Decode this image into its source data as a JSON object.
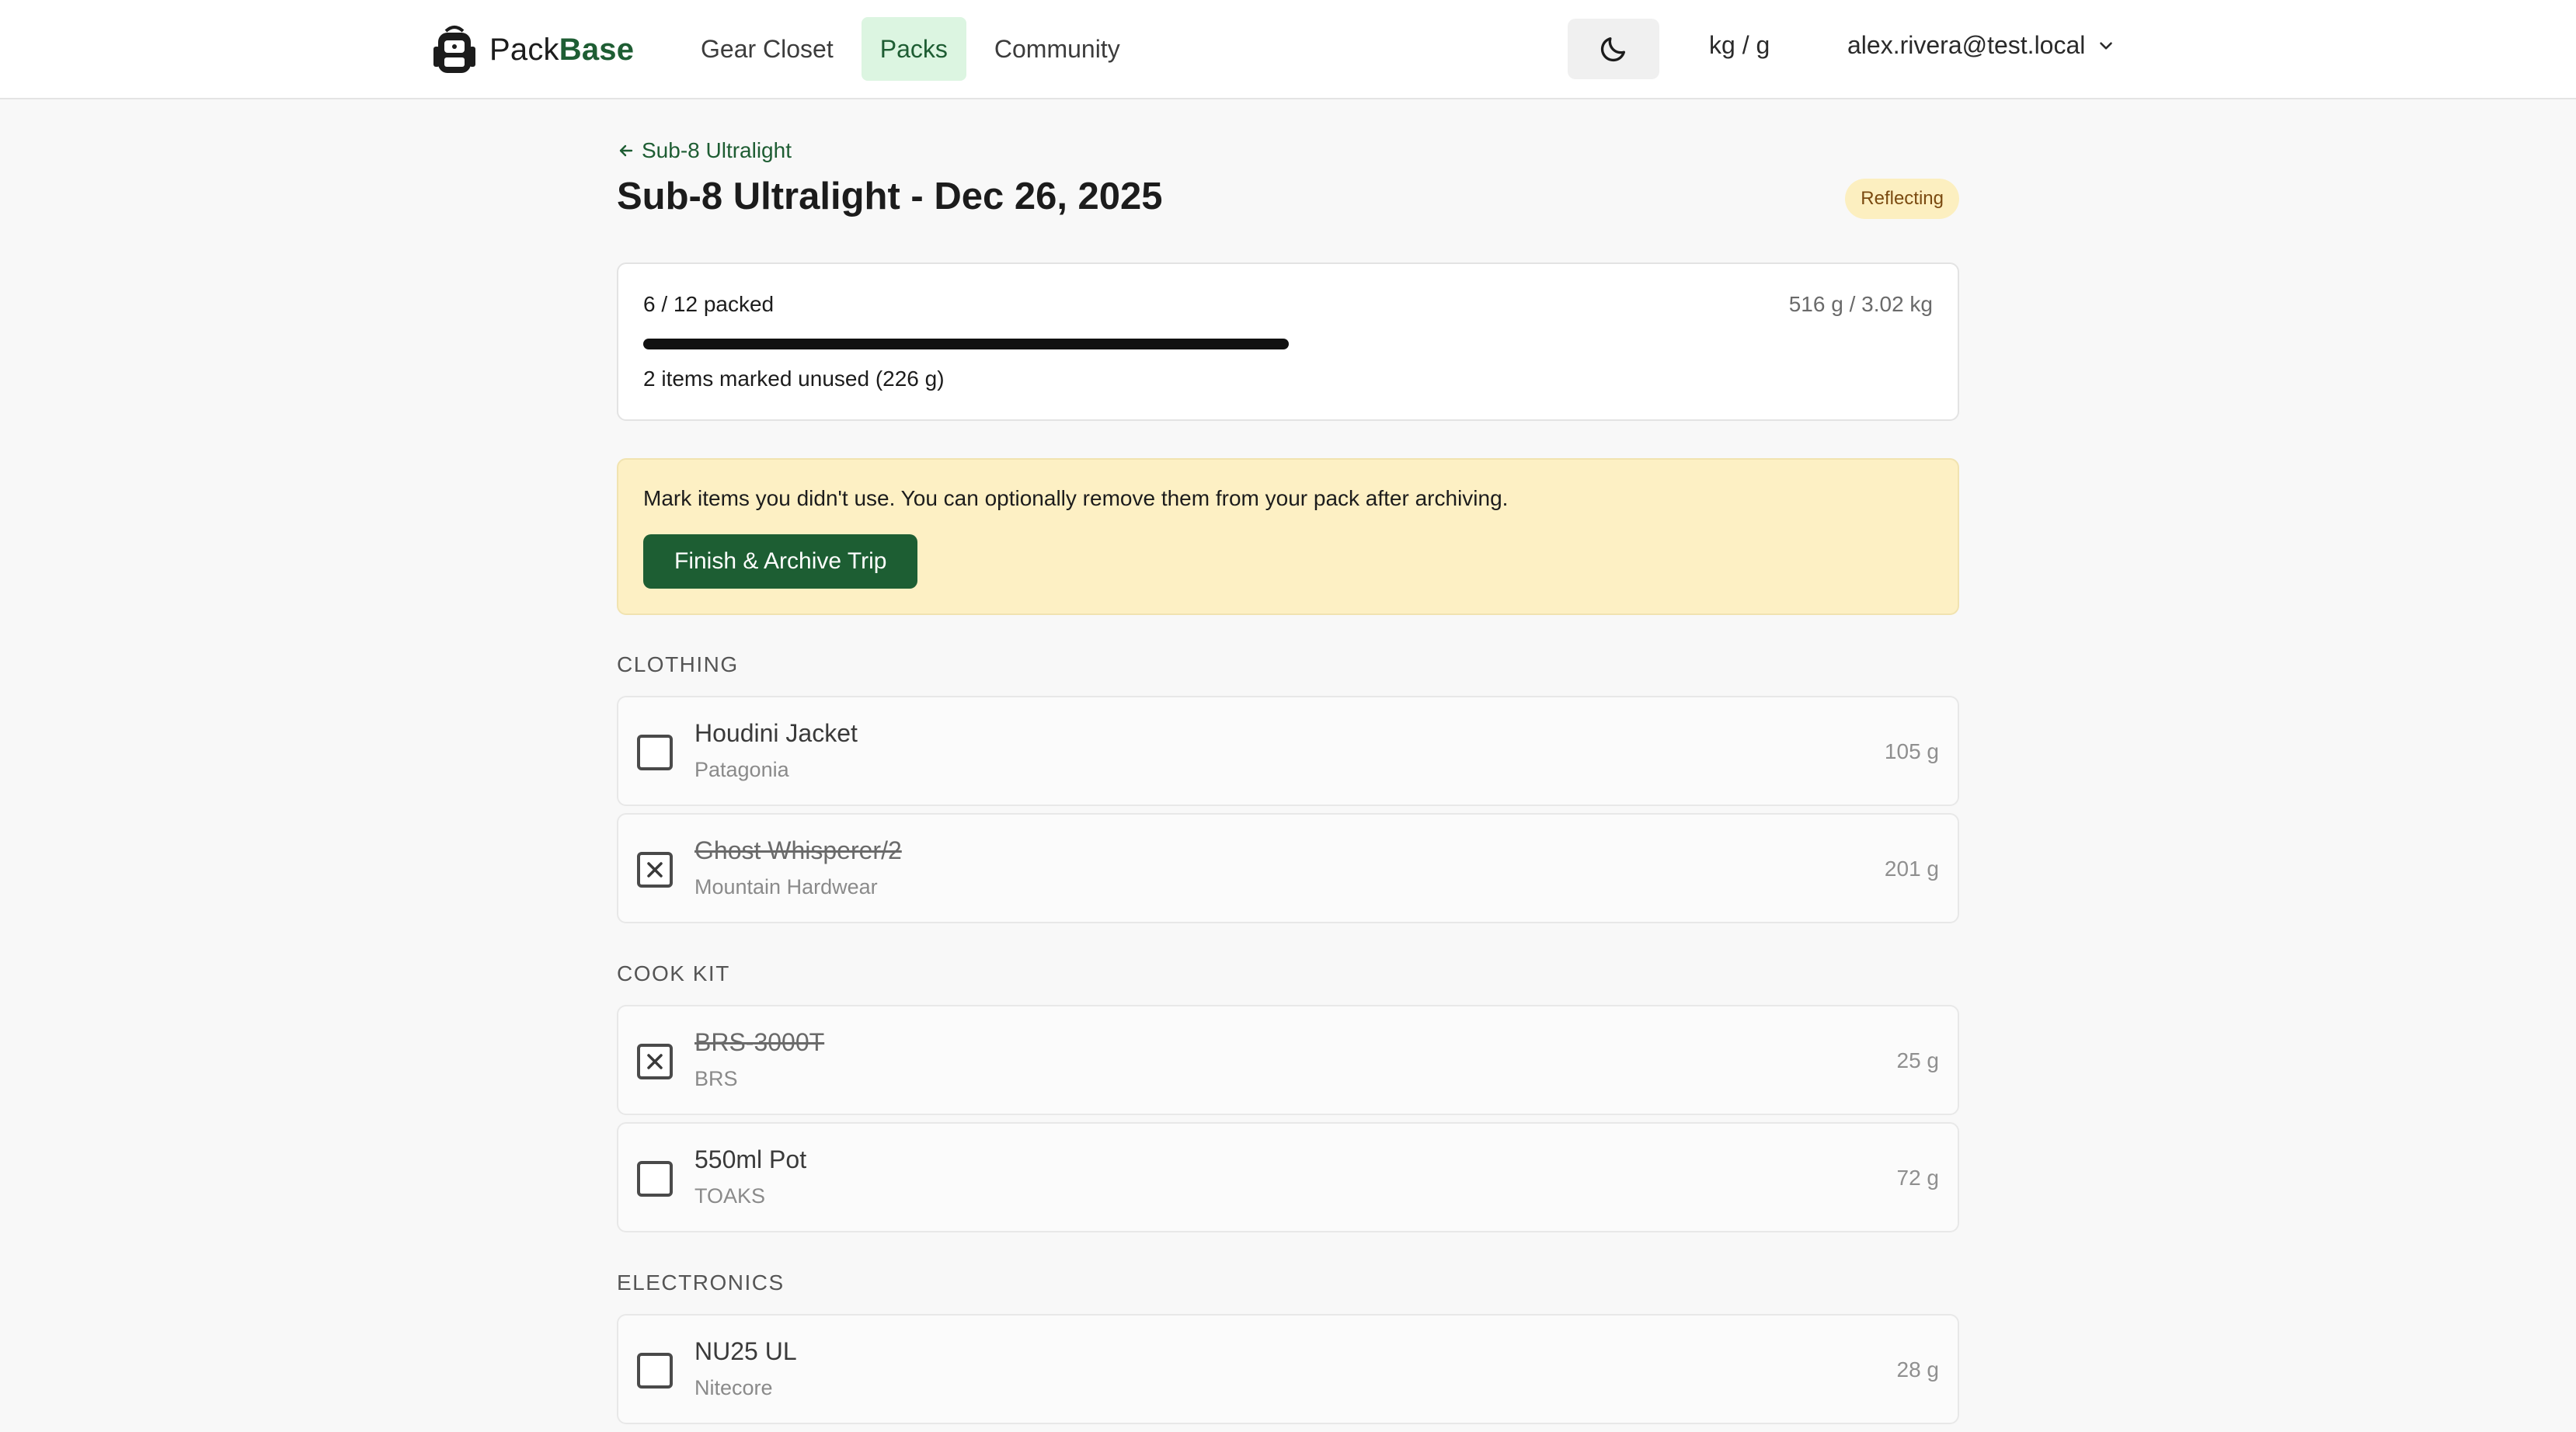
{
  "header": {
    "brand_prefix": "Pack",
    "brand_suffix": "Base",
    "nav": [
      {
        "label": "Gear Closet"
      },
      {
        "label": "Packs"
      },
      {
        "label": "Community"
      }
    ],
    "active_nav": "Packs",
    "units_label": "kg / g",
    "user_email": "alex.rivera@test.local",
    "theme_icon": "moon-icon"
  },
  "trip": {
    "back_label": "Sub-8 Ultralight",
    "title": "Sub-8 Ultralight - Dec 26, 2025",
    "status": "Reflecting"
  },
  "progress": {
    "packed_text": "6 / 12 packed",
    "packed_fraction": 0.5,
    "weight_text": "516 g / 3.02 kg",
    "unused_text": "2 items marked unused (226 g)"
  },
  "notice": {
    "text": "Mark items you didn't use. You can optionally remove them from your pack after archiving.",
    "button_label": "Finish & Archive Trip"
  },
  "sections": [
    {
      "heading": "CLOTHING",
      "items": [
        {
          "name": "Houdini Jacket",
          "brand": "Patagonia",
          "weight": "105 g",
          "unused": false
        },
        {
          "name": "Ghost Whisperer/2",
          "brand": "Mountain Hardwear",
          "weight": "201 g",
          "unused": true
        }
      ]
    },
    {
      "heading": "COOK KIT",
      "items": [
        {
          "name": "BRS-3000T",
          "brand": "BRS",
          "weight": "25 g",
          "unused": true
        },
        {
          "name": "550ml Pot",
          "brand": "TOAKS",
          "weight": "72 g",
          "unused": false
        }
      ]
    },
    {
      "heading": "ELECTRONICS",
      "items": [
        {
          "name": "NU25 UL",
          "brand": "Nitecore",
          "weight": "28 g",
          "unused": false
        }
      ]
    }
  ],
  "colors": {
    "accent": "#1e5d33",
    "nav_active_bg": "#dcf5e1",
    "status_bg": "#fcefc0",
    "notice_bg": "#fdf0c4",
    "progress_fill": "#111111"
  }
}
